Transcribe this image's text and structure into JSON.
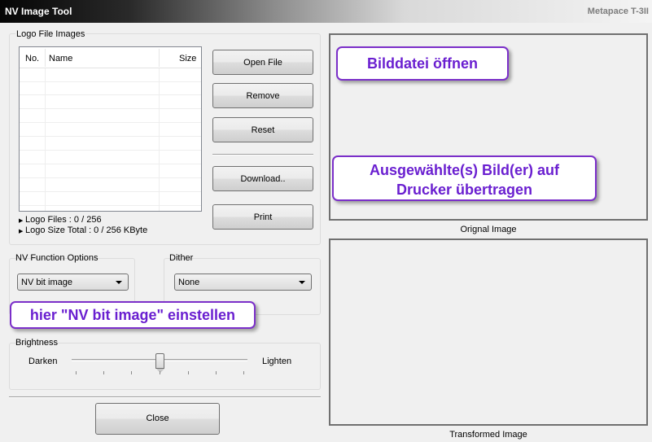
{
  "window": {
    "title": "NV Image Tool",
    "brand": "Metapace T-3II"
  },
  "logo_group": {
    "label": "Logo File Images",
    "columns": [
      "No.",
      "Name",
      "Size"
    ],
    "logo_files": "Logo Files : 0 / 256",
    "logo_size_total": "Logo Size Total : 0 / 256 KByte"
  },
  "buttons": {
    "open_file": "Open File",
    "remove": "Remove",
    "reset": "Reset",
    "download": "Download..",
    "print": "Print",
    "close": "Close"
  },
  "nv_function": {
    "label": "NV Function Options",
    "selected": "NV bit image"
  },
  "dither": {
    "label": "Dither",
    "selected": "None"
  },
  "brightness": {
    "label": "Brightness",
    "min_label": "Darken",
    "max_label": "Lighten",
    "level_fraction": 0.5
  },
  "images": {
    "original_caption": "Orignal Image",
    "transformed_caption": "Transformed Image"
  },
  "annotations": {
    "open_file_hint": "Bilddatei öffnen",
    "download_hint_line1": "Ausgewählte(s) Bild(er) auf",
    "download_hint_line2": "Drucker übertragen",
    "nv_hint": "hier \"NV bit image\" einstellen"
  },
  "colors": {
    "callout_text": "#6a1fd0",
    "callout_border": "#7b2fc9"
  }
}
